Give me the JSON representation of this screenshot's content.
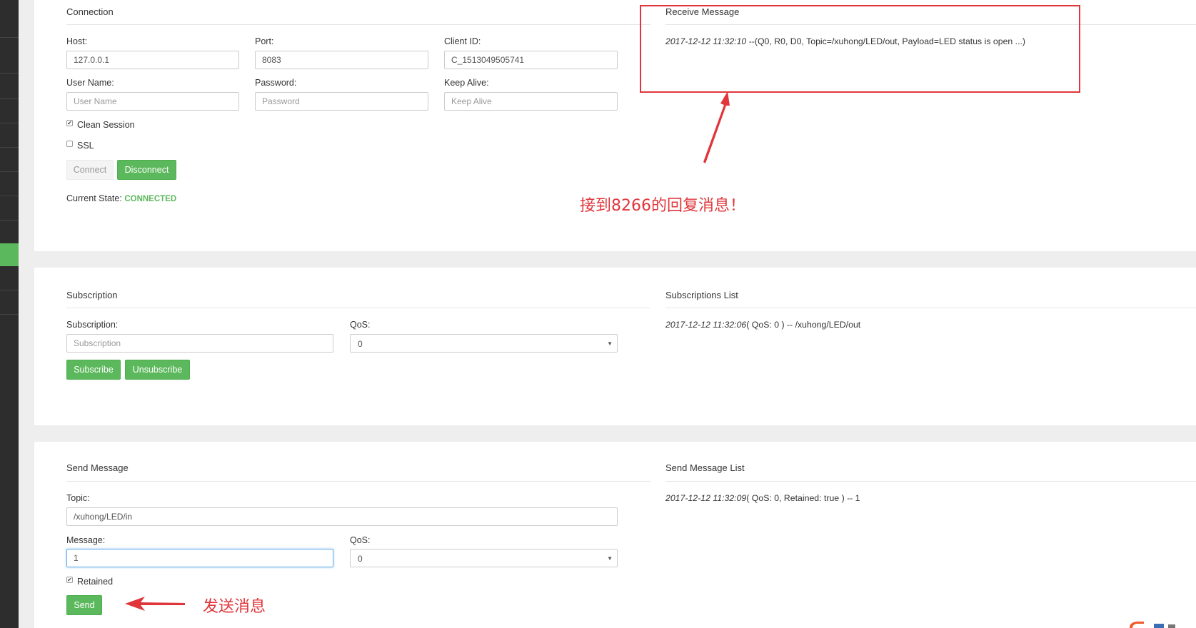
{
  "connection": {
    "title": "Connection",
    "host_label": "Host:",
    "host_value": "127.0.0.1",
    "port_label": "Port:",
    "port_value": "8083",
    "client_id_label": "Client ID:",
    "client_id_value": "C_1513049505741",
    "username_label": "User Name:",
    "username_placeholder": "User Name",
    "password_label": "Password:",
    "password_placeholder": "Password",
    "keepalive_label": "Keep Alive:",
    "keepalive_placeholder": "Keep Alive",
    "clean_session_label": "Clean Session",
    "clean_session_checked": true,
    "ssl_label": "SSL",
    "ssl_checked": false,
    "connect_label": "Connect",
    "disconnect_label": "Disconnect",
    "state_label": "Current State:",
    "state_value": "CONNECTED"
  },
  "receive": {
    "title": "Receive Message",
    "messages": [
      {
        "time": "2017-12-12 11:32:10",
        "text": " --(Q0, R0, D0, Topic=/xuhong/LED/out, Payload=LED status is open ...)"
      }
    ]
  },
  "subscription": {
    "title": "Subscription",
    "subscription_label": "Subscription:",
    "subscription_placeholder": "Subscription",
    "qos_label": "QoS:",
    "qos_value": "0",
    "subscribe_label": "Subscribe",
    "unsubscribe_label": "Unsubscribe"
  },
  "subscriptions_list": {
    "title": "Subscriptions List",
    "items": [
      {
        "time": "2017-12-12 11:32:06",
        "text": "( QoS: 0 ) -- /xuhong/LED/out"
      }
    ]
  },
  "send": {
    "title": "Send Message",
    "topic_label": "Topic:",
    "topic_value": "/xuhong/LED/in",
    "message_label": "Message:",
    "message_value": "1",
    "qos_label": "QoS:",
    "qos_value": "0",
    "retained_label": "Retained",
    "retained_checked": true,
    "send_label": "Send"
  },
  "send_list": {
    "title": "Send Message List",
    "items": [
      {
        "time": "2017-12-12 11:32:09",
        "text": "( QoS: 0, Retained: true ) -- 1"
      }
    ]
  },
  "annotations": {
    "receive_note": "接到8266的回复消息！",
    "send_note": "发送消息",
    "color": "#e0363b"
  },
  "colors": {
    "success": "#5cb85c",
    "sidebar": "#2d2d2d",
    "background": "#eeeeee"
  }
}
